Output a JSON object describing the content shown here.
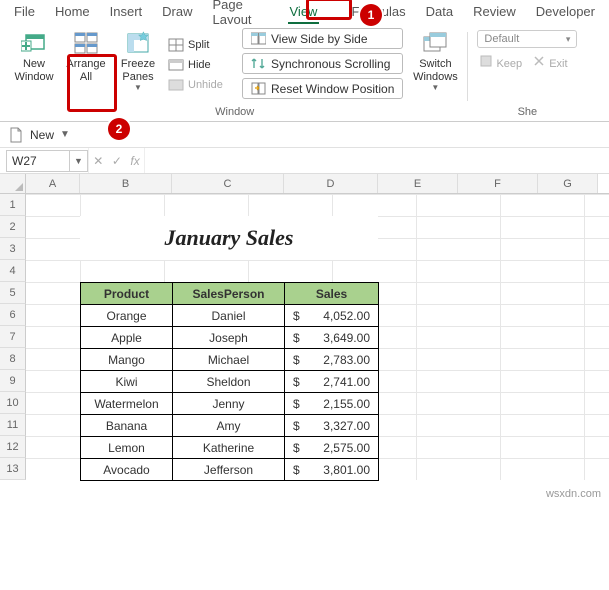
{
  "tabs": [
    "File",
    "Home",
    "Insert",
    "Draw",
    "Page Layout",
    "View",
    "Formulas",
    "Data",
    "Review",
    "Developer"
  ],
  "active_tab_index": 5,
  "ribbon": {
    "new_window": "New\nWindow",
    "arrange_all": "Arrange\nAll",
    "freeze_panes": "Freeze\nPanes",
    "split": "Split",
    "hide": "Hide",
    "unhide": "Unhide",
    "view_side": "View Side by Side",
    "sync_scroll": "Synchronous Scrolling",
    "reset_pos": "Reset Window Position",
    "switch_windows": "Switch\nWindows",
    "group_window": "Window",
    "macros_default": "Default",
    "keep": "Keep",
    "exit": "Exit",
    "group_she": "She"
  },
  "qat": {
    "new": "New"
  },
  "namebox": "W27",
  "column_headers": [
    "A",
    "B",
    "C",
    "D",
    "E",
    "F",
    "G"
  ],
  "row_headers": [
    "1",
    "2",
    "3",
    "4",
    "5",
    "6",
    "7",
    "8",
    "9",
    "10",
    "11",
    "12",
    "13"
  ],
  "title": "January Sales",
  "table": {
    "headers": [
      "Product",
      "SalesPerson",
      "Sales"
    ],
    "rows": [
      {
        "product": "Orange",
        "person": "Daniel",
        "sales": "4,052.00"
      },
      {
        "product": "Apple",
        "person": "Joseph",
        "sales": "3,649.00"
      },
      {
        "product": "Mango",
        "person": "Michael",
        "sales": "2,783.00"
      },
      {
        "product": "Kiwi",
        "person": "Sheldon",
        "sales": "2,741.00"
      },
      {
        "product": "Watermelon",
        "person": "Jenny",
        "sales": "2,155.00"
      },
      {
        "product": "Banana",
        "person": "Amy",
        "sales": "3,327.00"
      },
      {
        "product": "Lemon",
        "person": "Katherine",
        "sales": "2,575.00"
      },
      {
        "product": "Avocado",
        "person": "Jefferson",
        "sales": "3,801.00"
      }
    ]
  },
  "watermark": "wsxdn.com"
}
